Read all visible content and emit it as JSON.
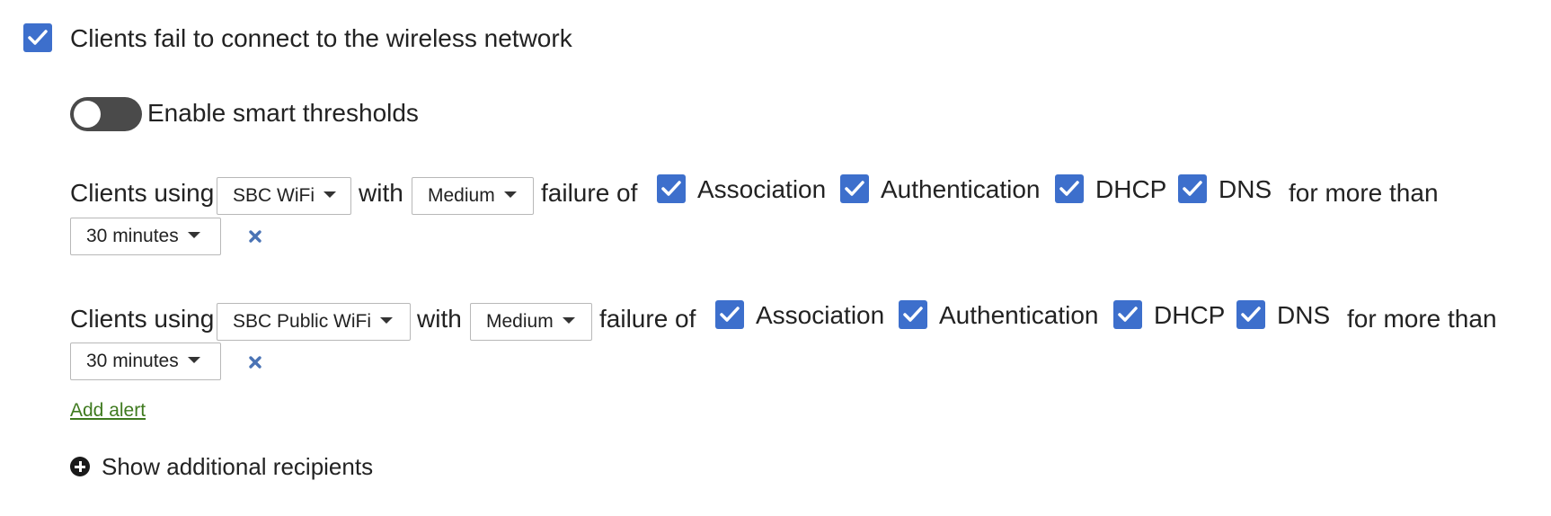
{
  "main_checkbox": {
    "label": "Clients fail to connect to the wireless network",
    "checked": true
  },
  "smart_thresholds": {
    "label": "Enable smart thresholds",
    "enabled": false
  },
  "alerts": [
    {
      "prefix": "Clients using",
      "network": "SBC WiFi",
      "with_text": "with",
      "severity": "Medium",
      "failure_text": "failure of",
      "checks": [
        {
          "label": "Association",
          "checked": true
        },
        {
          "label": "Authentication",
          "checked": true
        },
        {
          "label": "DHCP",
          "checked": true
        },
        {
          "label": "DNS",
          "checked": true
        }
      ],
      "suffix": "for more than",
      "duration": "30 minutes",
      "remove_icon": "close-icon"
    },
    {
      "prefix": "Clients using",
      "network": "SBC Public WiFi",
      "with_text": "with",
      "severity": "Medium",
      "failure_text": "failure of",
      "checks": [
        {
          "label": "Association",
          "checked": true
        },
        {
          "label": "Authentication",
          "checked": true
        },
        {
          "label": "DHCP",
          "checked": true
        },
        {
          "label": "DNS",
          "checked": true
        }
      ],
      "suffix": "for more than",
      "duration": "30 minutes",
      "remove_icon": "close-icon"
    }
  ],
  "add_alert_label": "Add alert",
  "show_recipients_label": "Show additional recipients",
  "colors": {
    "checkbox": "#3d6fcc",
    "toggle_off": "#4a4a4a",
    "link_green": "#3f7a1f",
    "remove_icon": "#4a73b5"
  }
}
